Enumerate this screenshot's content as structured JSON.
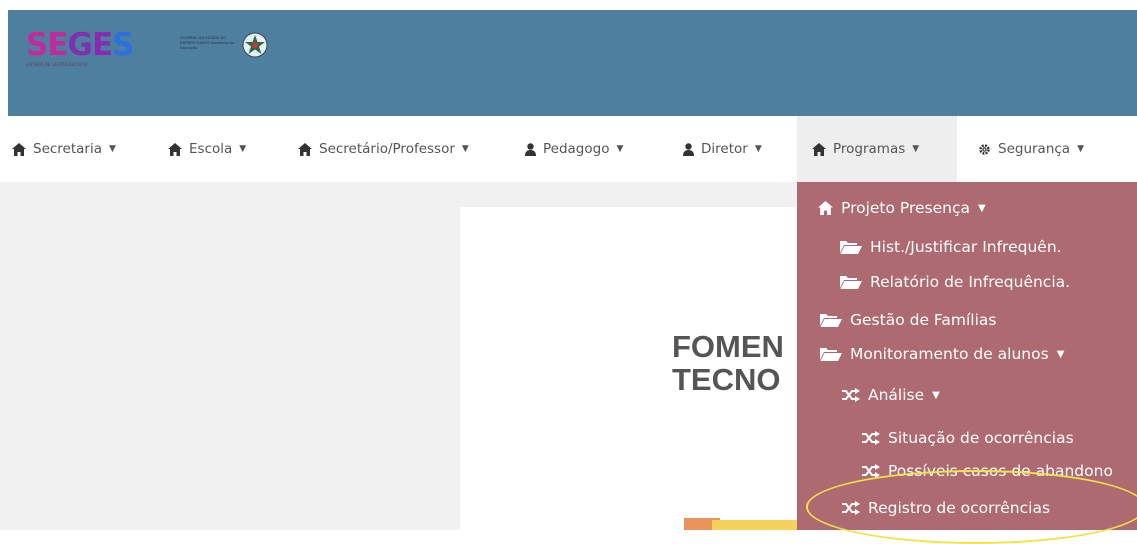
{
  "header": {
    "logo_text": "SEGES",
    "logo_subtitle": "SISTEMA DE GESTÃO ESCOLAR",
    "gov_text": "GOVERNO DO ESTADO DO ESPÍRITO SANTO Secretaria da Educação",
    "bg_color": "#4e7f9f"
  },
  "nav": {
    "items": [
      {
        "label": "Secretaria",
        "icon": "home-icon"
      },
      {
        "label": "Escola",
        "icon": "home-icon"
      },
      {
        "label": "Secretário/Professor",
        "icon": "home-icon"
      },
      {
        "label": "Pedagogo",
        "icon": "user-icon"
      },
      {
        "label": "Diretor",
        "icon": "user-icon"
      },
      {
        "label": "Programas",
        "icon": "home-icon",
        "active": true
      },
      {
        "label": "Segurança",
        "icon": "gear-icon"
      }
    ]
  },
  "main": {
    "title": "FOMEN\nTECNO"
  },
  "dropdown": {
    "bg_color": "#ad6a70",
    "items": [
      {
        "label": "Projeto Presença",
        "icon": "home-icon",
        "caret": true
      },
      {
        "label": "Hist./Justificar Infrequên.",
        "icon": "folder-open-icon"
      },
      {
        "label": "Relatório de Infrequência.",
        "icon": "folder-open-icon"
      },
      {
        "label": "Gestão de Famílias",
        "icon": "folder-open-icon"
      },
      {
        "label": "Monitoramento de alunos",
        "icon": "folder-open-icon",
        "caret": true
      },
      {
        "label": "Análise",
        "icon": "shuffle-icon",
        "caret": true
      },
      {
        "label": "Situação de ocorrências",
        "icon": "shuffle-icon"
      },
      {
        "label": "Possíveis casos de abandono",
        "icon": "shuffle-icon"
      },
      {
        "label": "Registro de ocorrências",
        "icon": "shuffle-icon"
      }
    ]
  },
  "annotation_color": "#f0e24a"
}
